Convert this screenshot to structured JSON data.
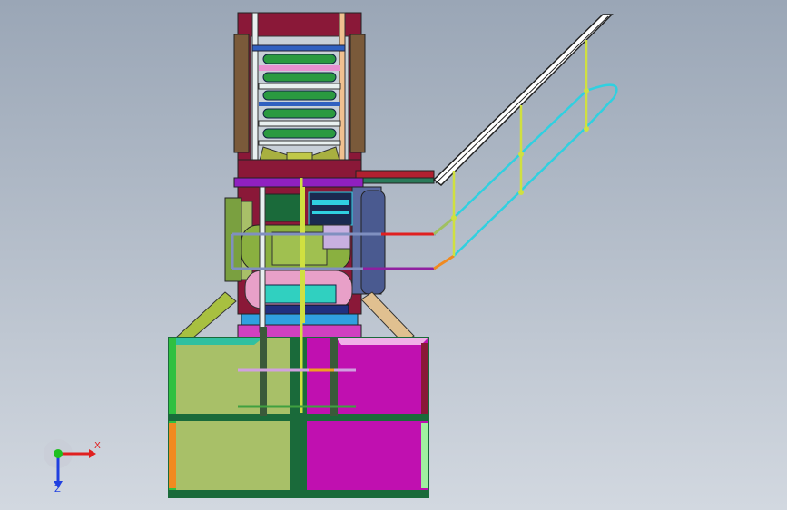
{
  "viewport": {
    "background_top": "#9aa6b6",
    "background_bottom": "#d2d8e0"
  },
  "triad": {
    "x_label": "X",
    "z_label": "Z",
    "x_color": "#e02020",
    "y_color": "#20c020",
    "z_color": "#2040e0"
  },
  "colors": {
    "olive": "#a8c068",
    "magenta": "#c010b0",
    "dark_green": "#1a6a3a",
    "maroon": "#8a1838",
    "brown": "#7a5a3a",
    "cyan": "#30d0e0",
    "yellow_green": "#d0e040",
    "green_pipe": "#4a9a30",
    "purple": "#9020c0",
    "pink": "#e890d0",
    "navy": "#203080",
    "orange": "#f08a20"
  }
}
